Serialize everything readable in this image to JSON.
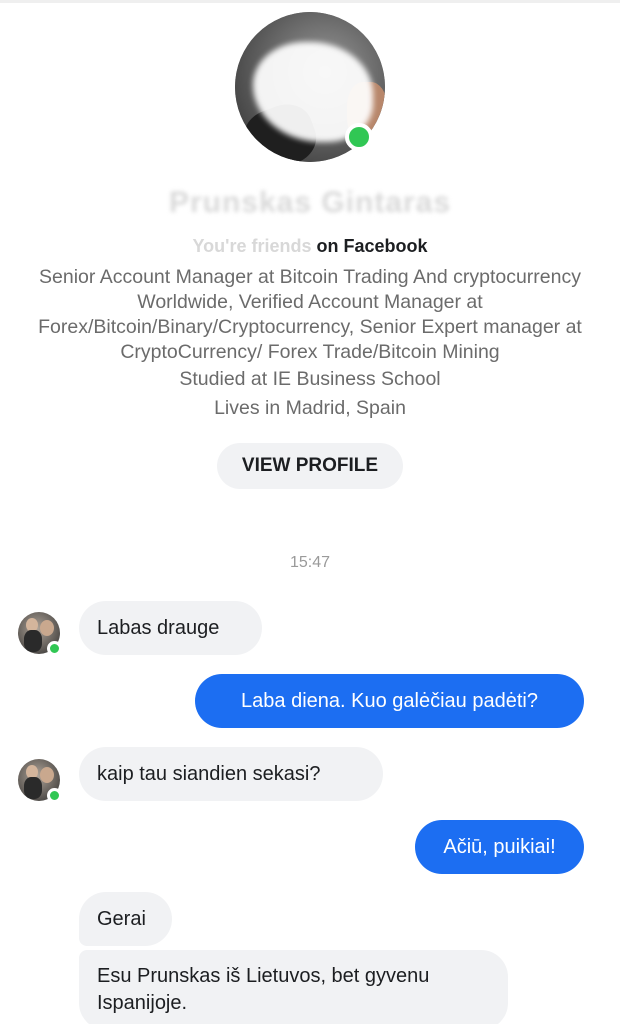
{
  "profile": {
    "name": "Prunskas Gintaras",
    "friends_prefix": "You're friends",
    "friends_suffix": " on Facebook",
    "bio": "Senior Account Manager at Bitcoin Trading And cryptocurrency Worldwide, Verified Account Manager at Forex/Bitcoin/Binary/Cryptocurrency, Senior Expert manager at CryptoCurrency/ Forex Trade/Bitcoin Mining",
    "education": "Studied at IE Business School",
    "location": "Lives in Madrid, Spain",
    "view_profile_label": "VIEW PROFILE",
    "online": true
  },
  "chat": {
    "timestamp": "15:47",
    "messages": [
      {
        "direction": "in",
        "text": "Labas drauge"
      },
      {
        "direction": "out",
        "text": "Laba diena. Kuo galėčiau padėti?"
      },
      {
        "direction": "in",
        "text": "kaip tau siandien sekasi?"
      },
      {
        "direction": "out",
        "text": "Ačiū, puikiai!"
      },
      {
        "direction": "in",
        "text": "Gerai"
      },
      {
        "direction": "in",
        "text": "Esu Prunskas iš Lietuvos, bet gyvenu Ispanijoje."
      }
    ]
  },
  "colors": {
    "outgoing_bubble": "#1c6ef2",
    "incoming_bubble": "#f1f2f4",
    "online": "#31c754"
  }
}
